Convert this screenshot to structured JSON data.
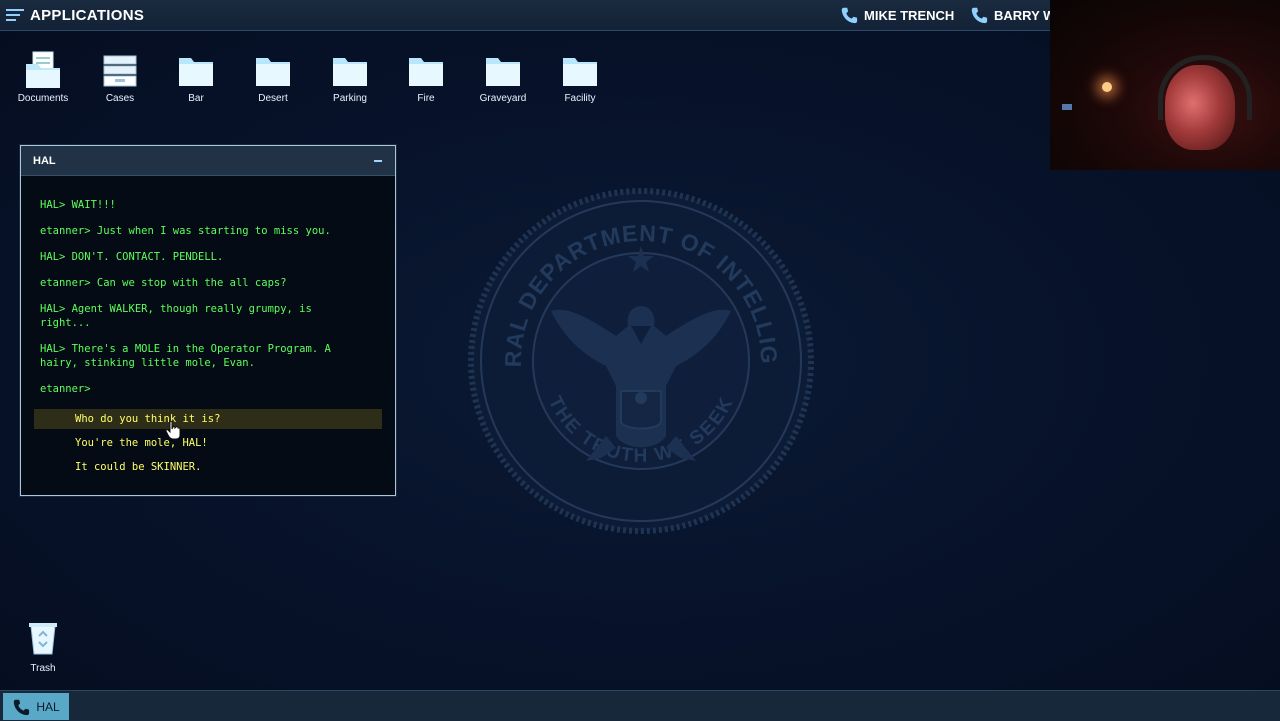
{
  "topbar": {
    "menu_label": "APPLICATIONS",
    "contacts": [
      {
        "name": "MIKE TRENCH",
        "icon": "phone-icon"
      },
      {
        "name": "BARRY WA",
        "icon": "phone-icon"
      }
    ]
  },
  "desktop_icons": [
    {
      "label": "Documents",
      "icon": "documents-icon"
    },
    {
      "label": "Cases",
      "icon": "cases-icon"
    },
    {
      "label": "Bar",
      "icon": "folder-icon"
    },
    {
      "label": "Desert",
      "icon": "folder-icon"
    },
    {
      "label": "Parking",
      "icon": "folder-icon"
    },
    {
      "label": "Fire",
      "icon": "folder-icon"
    },
    {
      "label": "Graveyard",
      "icon": "folder-icon"
    },
    {
      "label": "Facility",
      "icon": "folder-icon"
    }
  ],
  "seal": {
    "top_text": "FEDERAL DEPARTMENT OF INTELLIGENCE",
    "bottom_text": "THE TRUTH WE SEEK"
  },
  "hal_window": {
    "title": "HAL",
    "lines": [
      "HAL> WAIT!!!",
      "etanner> Just when I was starting to miss you.",
      "HAL> DON'T. CONTACT. PENDELL.",
      "etanner> Can we stop with the all caps?",
      "HAL> Agent WALKER, though really grumpy, is right...",
      "HAL> There's a MOLE in the Operator Program. A hairy, stinking little mole, Evan.",
      "etanner>"
    ],
    "choices": [
      "Who do you think it is?",
      "You're the mole, HAL!",
      "It could be SKINNER."
    ]
  },
  "trash": {
    "label": "Trash"
  },
  "taskbar": {
    "item_label": "HAL"
  },
  "colors": {
    "terminal_green": "#5cff5c",
    "choice_yellow": "#ffff66",
    "accent_blue": "#5aa8c8"
  }
}
